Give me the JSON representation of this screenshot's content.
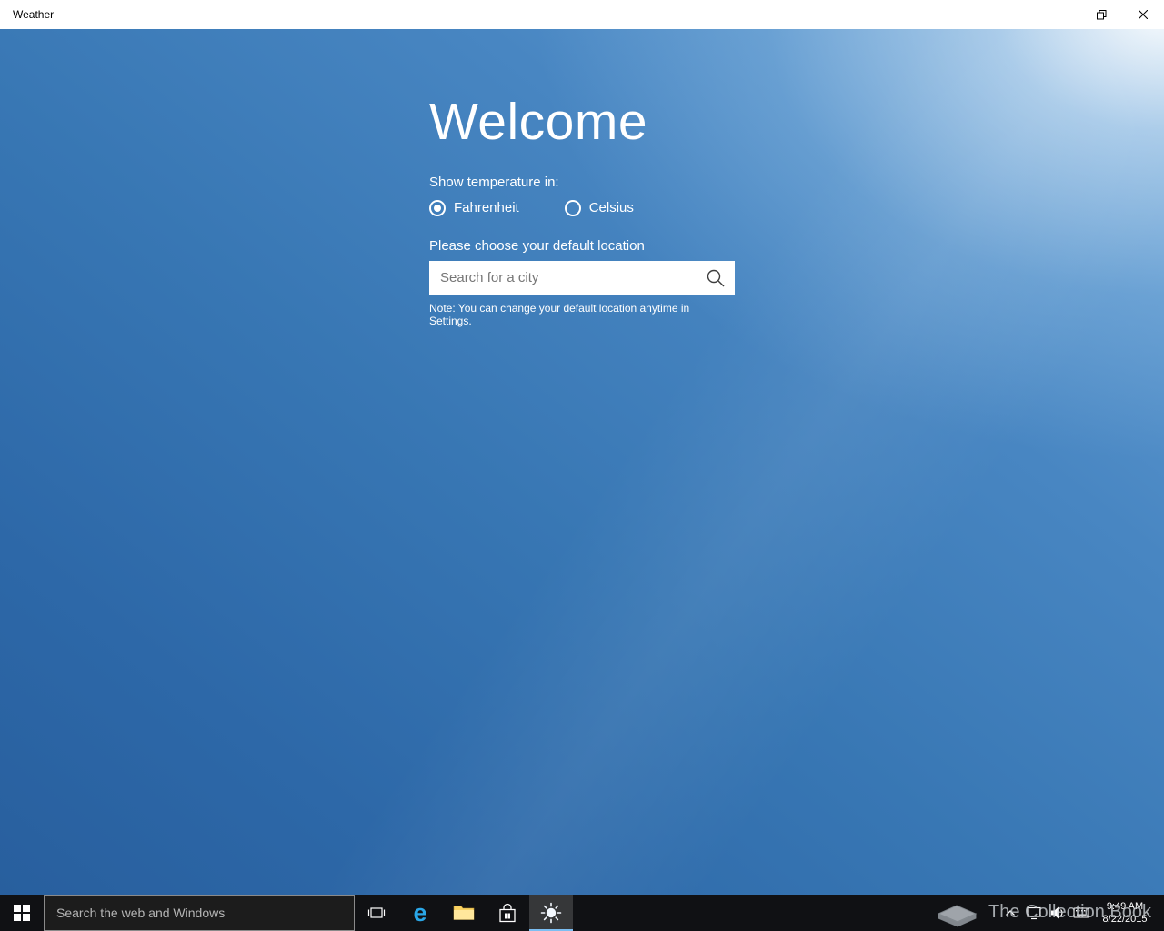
{
  "window": {
    "title": "Weather"
  },
  "welcome": {
    "heading": "Welcome",
    "temperature_label": "Show temperature in:",
    "units": [
      {
        "label": "Fahrenheit",
        "selected": true
      },
      {
        "label": "Celsius",
        "selected": false
      }
    ],
    "location_label": "Please choose your default location",
    "search": {
      "placeholder": "Search for a city"
    },
    "note": "Note: You can change your default location anytime in Settings."
  },
  "taskbar": {
    "search": {
      "placeholder": "Search the web and Windows"
    },
    "apps": [
      "start",
      "task-view",
      "edge",
      "file-explorer",
      "store",
      "weather"
    ],
    "active_app": "weather",
    "tray_icons": [
      "chevron-up",
      "network",
      "volume",
      "touch-keyboard"
    ],
    "clock": {
      "time": "9:49 AM",
      "date": "8/22/2015"
    }
  },
  "watermark": {
    "text": "The Collection Book"
  },
  "colors": {
    "sky_mid": "#3877b4",
    "sky_dark": "#285f9e",
    "taskbar": "#101114",
    "title_bar": "#ffffff",
    "edge_blue": "#2aa7e8",
    "active_underline": "#7cbef2"
  },
  "icons": {
    "search": "magnifier",
    "start": "windows-logo",
    "weather": "sun",
    "watermark_logo": "book"
  }
}
